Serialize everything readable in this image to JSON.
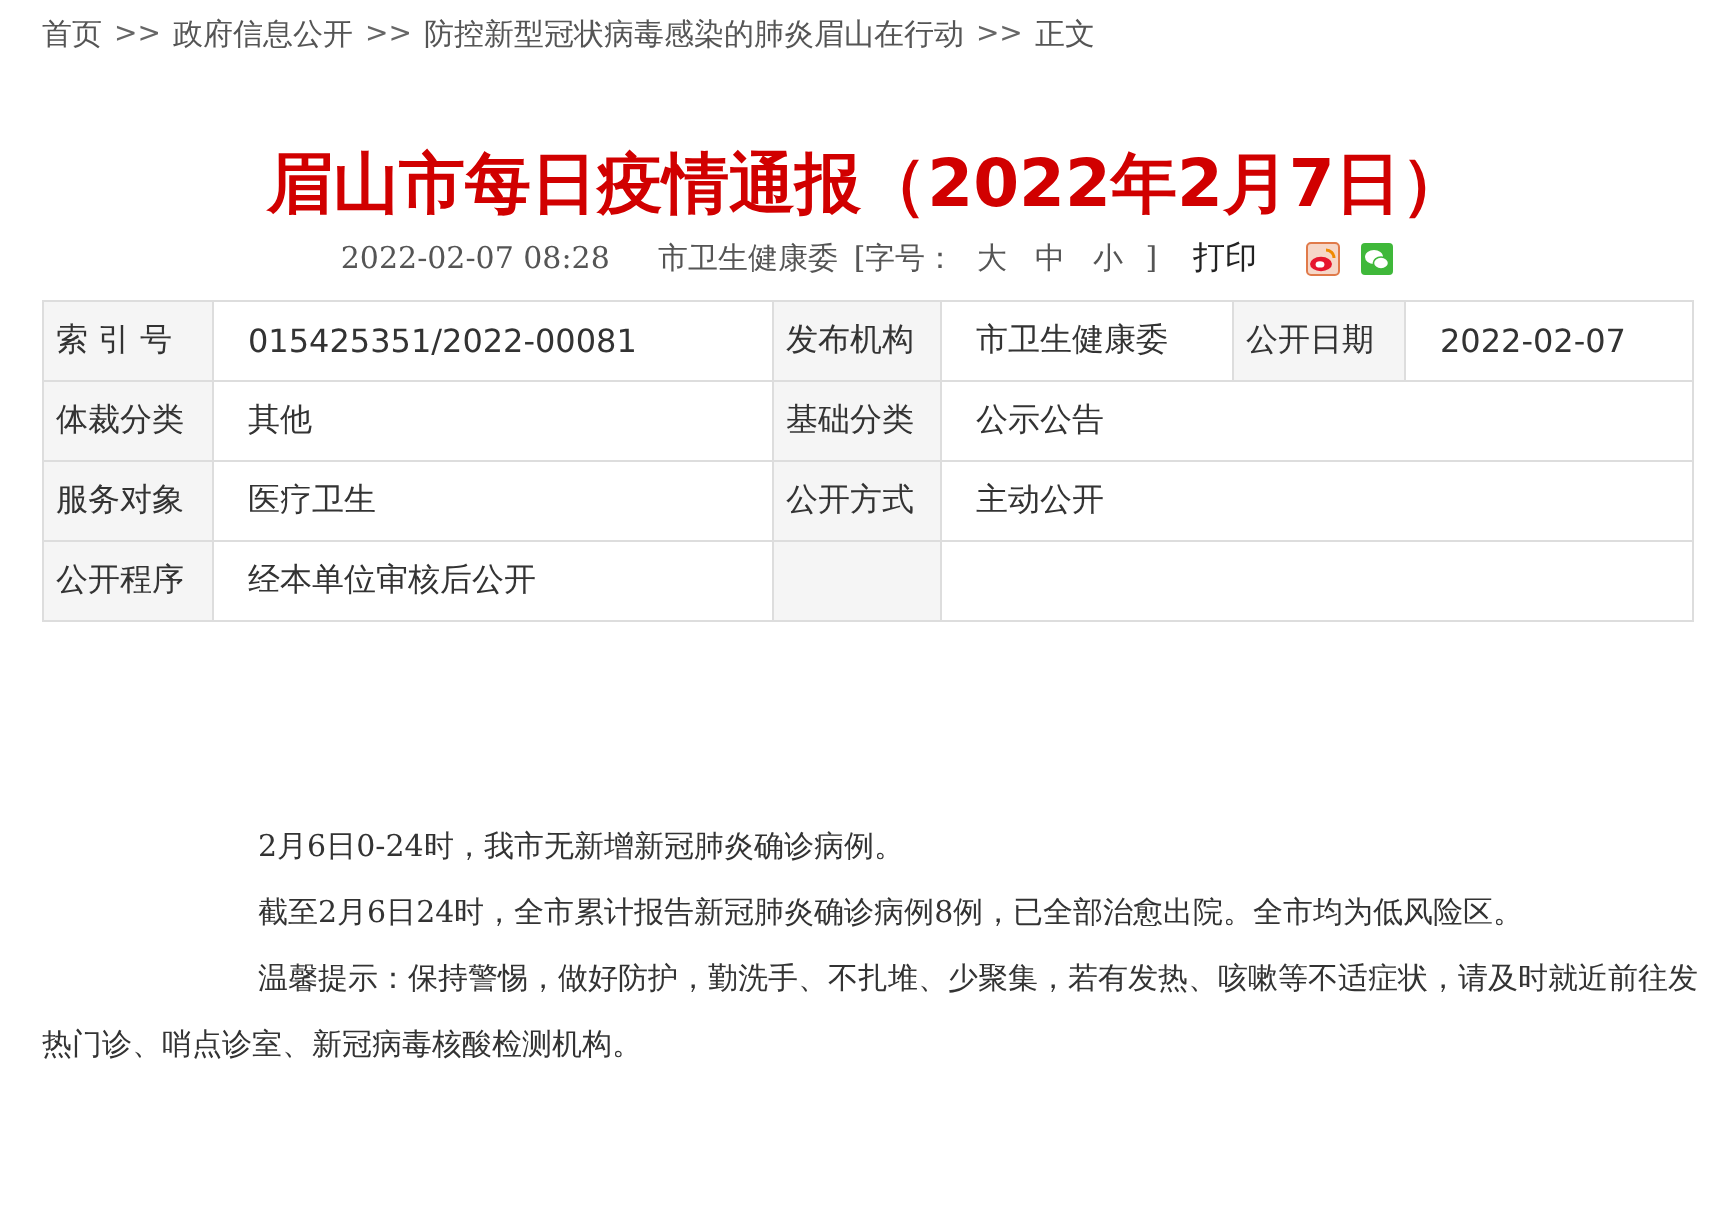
{
  "breadcrumb": {
    "items": [
      "首页",
      "政府信息公开",
      "防控新型冠状病毒感染的肺炎眉山在行动",
      "正文"
    ],
    "separator": ">>"
  },
  "title": "眉山市每日疫情通报（2022年2月7日）",
  "meta": {
    "datetime": "2022-02-07 08:28",
    "source": "市卫生健康委",
    "font_size_label": "[字号：",
    "font_sizes": [
      "大",
      "中",
      "小"
    ],
    "font_size_end": "]",
    "print": "打印"
  },
  "info_table": {
    "rows": [
      [
        {
          "kind": "label",
          "text": "索 引 号"
        },
        {
          "kind": "value",
          "text": "015425351/2022-00081"
        },
        {
          "kind": "label",
          "text": "发布机构"
        },
        {
          "kind": "value",
          "text": "市卫生健康委"
        },
        {
          "kind": "label",
          "text": "公开日期"
        },
        {
          "kind": "value",
          "text": "2022-02-07"
        }
      ],
      [
        {
          "kind": "label",
          "text": "体裁分类"
        },
        {
          "kind": "value",
          "text": "其他"
        },
        {
          "kind": "label",
          "text": "基础分类"
        },
        {
          "kind": "wide",
          "text": "公示公告"
        }
      ],
      [
        {
          "kind": "label",
          "text": "服务对象"
        },
        {
          "kind": "value",
          "text": "医疗卫生"
        },
        {
          "kind": "label",
          "text": "公开方式"
        },
        {
          "kind": "wide",
          "text": "主动公开"
        }
      ],
      [
        {
          "kind": "label",
          "text": "公开程序"
        },
        {
          "kind": "value",
          "text": "经本单位审核后公开"
        },
        {
          "kind": "label"
        },
        {
          "kind": "wide"
        }
      ]
    ]
  },
  "body": [
    "2月6日0-24时，我市无新增新冠肺炎确诊病例。",
    "截至2月6日24时，全市累计报告新冠肺炎确诊病例8例，已全部治愈出院。全市均为低风险区。",
    "温馨提示：保持警惕，做好防护，勤洗手、不扎堆、少聚集，若有发热、咳嗽等不适症状，请及时就近前往发热门诊、哨点诊室、新冠病毒核酸检测机构。"
  ]
}
